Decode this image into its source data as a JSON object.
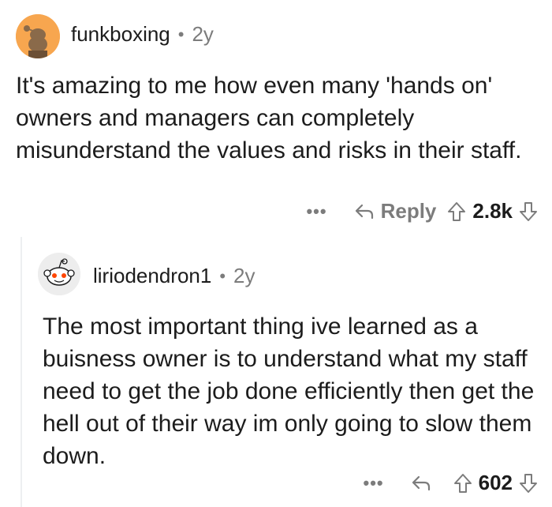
{
  "comments": [
    {
      "username": "funkboxing",
      "separator": "•",
      "age": "2y",
      "body": "It's amazing to me how even many 'hands on' owners and managers can completely misunderstand the values and risks in their staff.",
      "more_label": "•••",
      "reply_label": "Reply",
      "score": "2.8k",
      "avatar_color": "#f7a64f"
    },
    {
      "username": "liriodendron1",
      "separator": "•",
      "age": "2y",
      "body": "The most important thing ive learned as a buisness owner is to understand what my staff need to get the job done efficiently then get the hell out of their way im only going to slow them down.",
      "more_label": "•••",
      "score": "602",
      "avatar_color": "#ededed"
    }
  ],
  "icons": {
    "reply": "reply-arrow-icon",
    "upvote": "upvote-arrow-icon",
    "downvote": "downvote-arrow-icon",
    "more": "more-dots-icon"
  }
}
